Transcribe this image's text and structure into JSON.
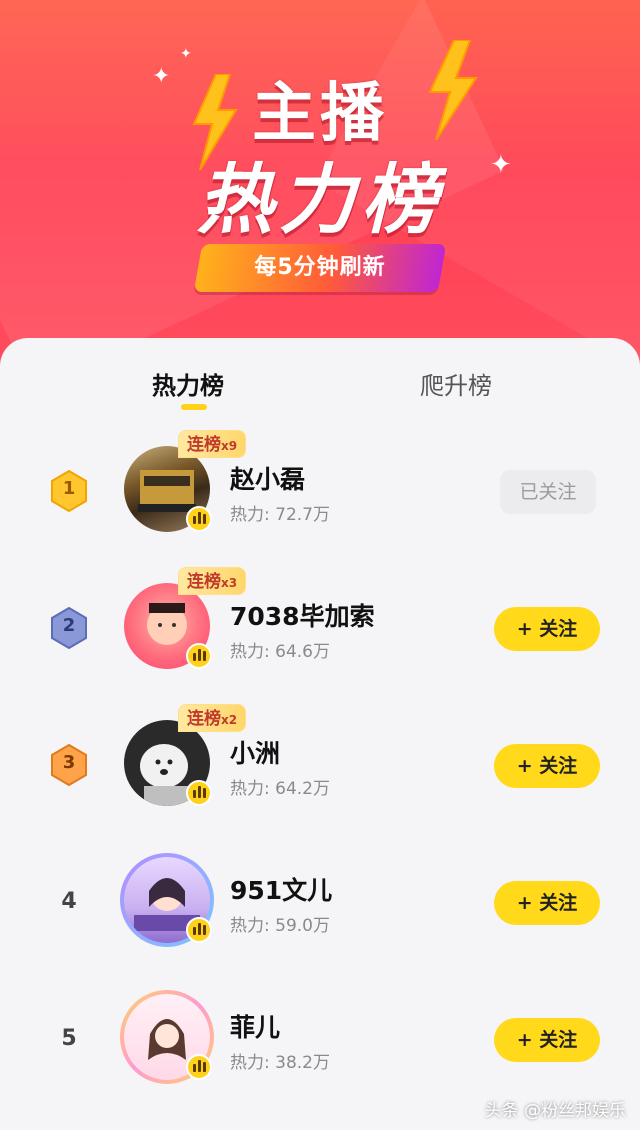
{
  "banner": {
    "title_line1": "主播",
    "title_line2": "热力榜",
    "refresh_label": "每5分钟刷新",
    "colors": {
      "top": "#ff5a46",
      "bottom": "#ff4d5e",
      "accent": "#ffd11a"
    }
  },
  "tabs": [
    {
      "label": "热力榜",
      "active": true
    },
    {
      "label": "爬升榜",
      "active": false
    }
  ],
  "list": [
    {
      "rank": "1",
      "name": "赵小磊",
      "heat": "热力: 72.7万",
      "streak": "连榜",
      "streak_count": "x9",
      "follow_label": "已关注",
      "followed": true
    },
    {
      "rank": "2",
      "name": "7038毕加索",
      "heat": "热力: 64.6万",
      "streak": "连榜",
      "streak_count": "x3",
      "follow_label": "+ 关注",
      "followed": false
    },
    {
      "rank": "3",
      "name": "小洲",
      "heat": "热力: 64.2万",
      "streak": "连榜",
      "streak_count": "x2",
      "follow_label": "+ 关注",
      "followed": false
    },
    {
      "rank": "4",
      "name": "951文儿",
      "heat": "热力: 59.0万",
      "follow_label": "+ 关注",
      "followed": false
    },
    {
      "rank": "5",
      "name": "菲儿",
      "heat": "热力: 38.2万",
      "follow_label": "+ 关注",
      "followed": false
    }
  ],
  "watermark": "头条 @粉丝邦娱乐"
}
